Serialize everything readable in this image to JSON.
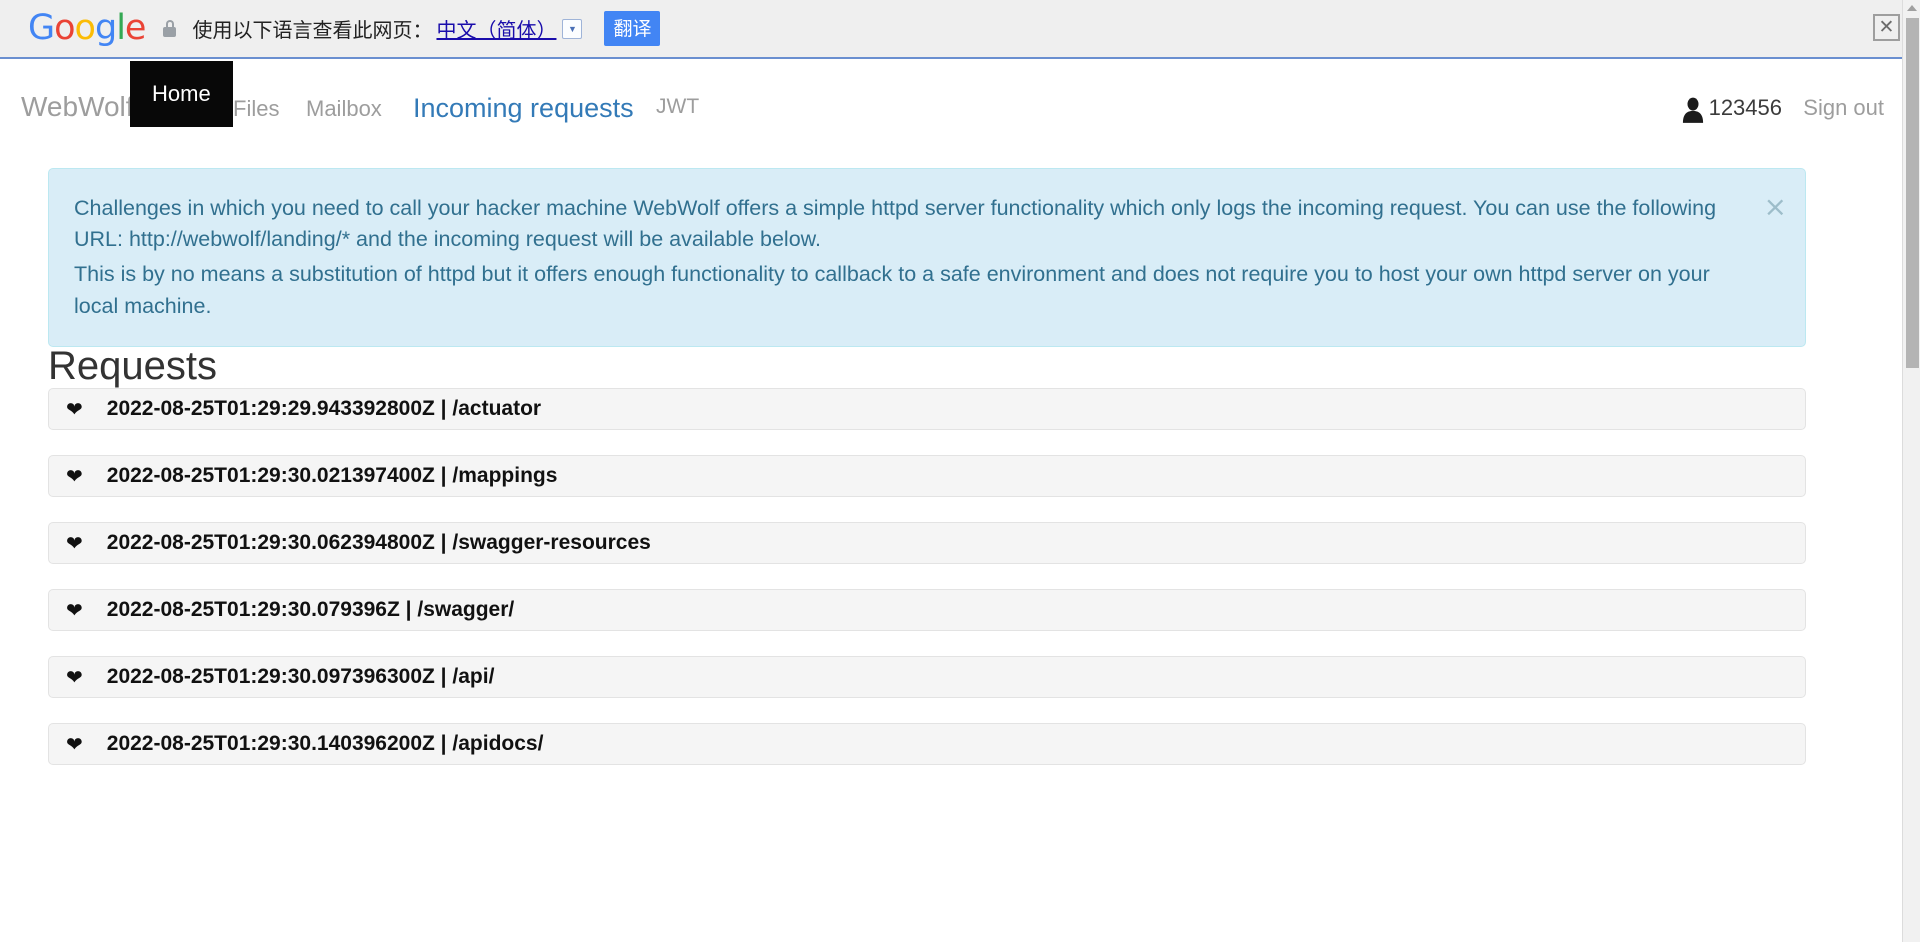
{
  "translate_bar": {
    "logo_text": "Google",
    "lock_icon": "lock-icon",
    "label": "使用以下语言查看此网页：",
    "language": "中文（简体）",
    "caret_glyph": "▼",
    "submit_label": "翻译",
    "close_glyph": "✕"
  },
  "navbar": {
    "brand": "WebWolf",
    "items": [
      {
        "label": "Home",
        "active": true
      },
      {
        "label": "Files",
        "active": false
      },
      {
        "label": "Mailbox",
        "active": false
      }
    ],
    "page_title": "Incoming requests",
    "jwt_label": "JWT",
    "user_icon": "user-icon",
    "username": "123456",
    "signout_label": "Sign out"
  },
  "alert": {
    "paragraph1": "Challenges in which you need to call your hacker machine WebWolf offers a simple httpd server functionality which only logs the incoming request. You can use the following URL: http://webwolf/landing/* and the incoming request will be available below.",
    "paragraph2": "This is by no means a substitution of httpd but it offers enough functionality to callback to a safe environment and does not require you to host your own httpd server on your local machine.",
    "close_glyph": "×"
  },
  "requests": {
    "heading": "Requests",
    "caret_glyph": "❤",
    "rows": [
      {
        "label": "2022-08-25T01:29:29.943392800Z | /actuator"
      },
      {
        "label": "2022-08-25T01:29:30.021397400Z | /mappings"
      },
      {
        "label": "2022-08-25T01:29:30.062394800Z | /swagger-resources"
      },
      {
        "label": "2022-08-25T01:29:30.079396Z | /swagger/"
      },
      {
        "label": "2022-08-25T01:29:30.097396300Z | /api/"
      },
      {
        "label": "2022-08-25T01:29:30.140396200Z | /apidocs/"
      }
    ]
  },
  "scrollbar": {
    "arrow_up": "scroll-up-arrow"
  },
  "colors": {
    "accent": "#337ab7",
    "alert_bg": "#d9edf7",
    "alert_border": "#bce8f1",
    "alert_text": "#31708f",
    "active_nav_bg": "#080808",
    "row_bg": "#f5f5f5",
    "google_blue": "#4285f4"
  }
}
